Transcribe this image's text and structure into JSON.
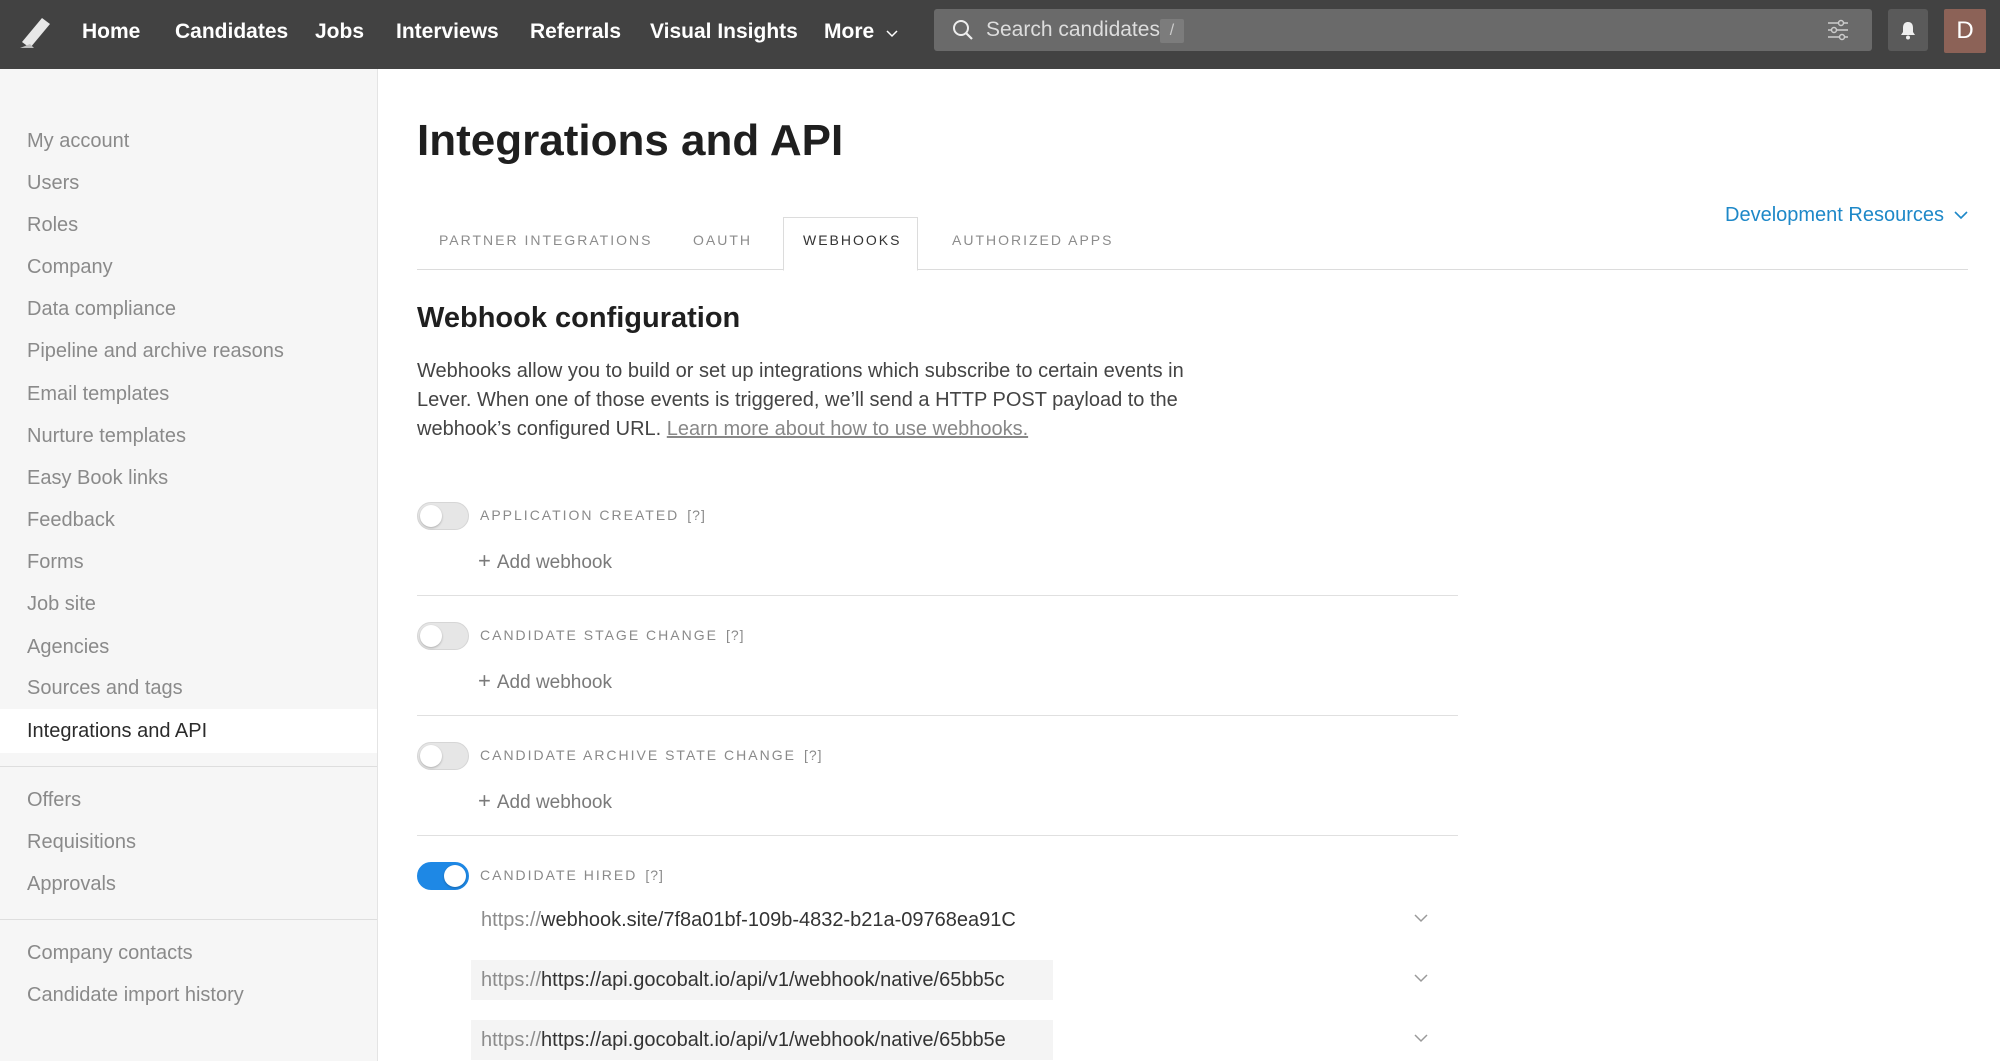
{
  "nav": {
    "items": [
      "Home",
      "Candidates",
      "Jobs",
      "Interviews",
      "Referrals",
      "Visual Insights",
      "More"
    ],
    "search_placeholder": "Search candidates",
    "search_shortcut": "/",
    "avatar_initial": "D"
  },
  "sidebar": {
    "group1": [
      "My account",
      "Users",
      "Roles",
      "Company",
      "Data compliance",
      "Pipeline and archive reasons",
      "Email templates",
      "Nurture templates",
      "Easy Book links",
      "Feedback",
      "Forms",
      "Job site",
      "Agencies",
      "Sources and tags",
      "Integrations and API"
    ],
    "group2": [
      "Offers",
      "Requisitions",
      "Approvals"
    ],
    "group3": [
      "Company contacts",
      "Candidate import history"
    ],
    "active": "Integrations and API"
  },
  "main": {
    "title": "Integrations and API",
    "dev_resources": "Development Resources",
    "tabs": [
      "PARTNER INTEGRATIONS",
      "OAUTH",
      "WEBHOOKS",
      "AUTHORIZED APPS"
    ],
    "active_tab": "WEBHOOKS",
    "section_title": "Webhook configuration",
    "description": "Webhooks allow you to build or set up integrations which subscribe to certain events in Lever. When one of those events is triggered, we’ll send a HTTP POST payload to the webhook’s configured URL. ",
    "learn_more": "Learn more about how to use webhooks.",
    "help_marker": "[?]",
    "add_webhook": "Add webhook",
    "url_prefix": "https://",
    "events": [
      {
        "label": "APPLICATION CREATED",
        "enabled": false
      },
      {
        "label": "CANDIDATE STAGE CHANGE",
        "enabled": false
      },
      {
        "label": "CANDIDATE ARCHIVE STATE CHANGE",
        "enabled": false
      },
      {
        "label": "CANDIDATE HIRED",
        "enabled": true
      }
    ],
    "hired_urls": [
      "webhook.site/7f8a01bf-109b-4832-b21a-09768ea91C",
      "https://api.gocobalt.io/api/v1/webhook/native/65bb5c",
      "https://api.gocobalt.io/api/v1/webhook/native/65bb5e"
    ]
  },
  "colors": {
    "topbar": "#424242",
    "accent_blue": "#1e88e5",
    "link_blue": "#1e88c8",
    "sidebar_bg": "#f6f6f6"
  }
}
